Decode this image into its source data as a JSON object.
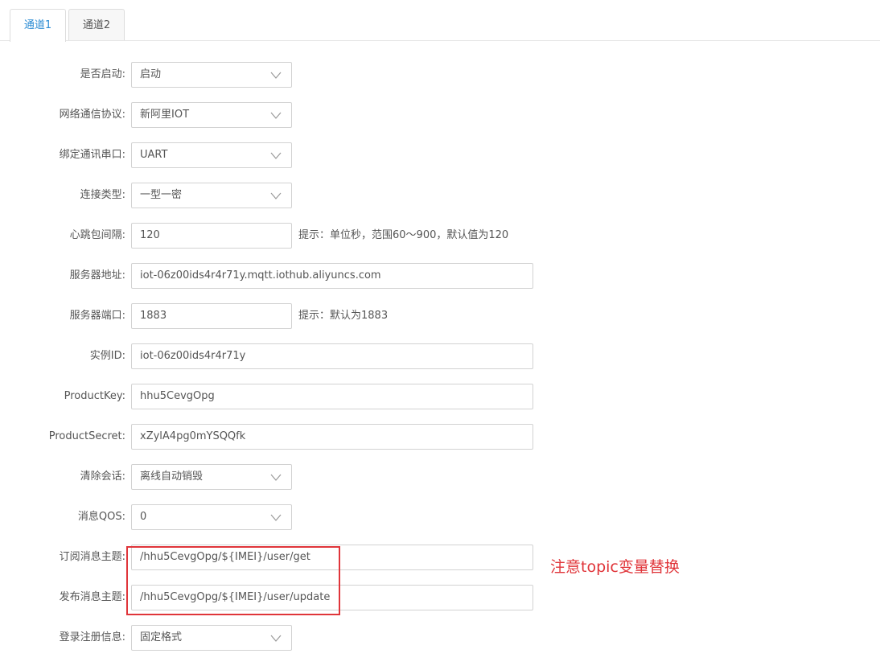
{
  "tabs": [
    {
      "label": "通道1",
      "active": true
    },
    {
      "label": "通道2",
      "active": false
    }
  ],
  "form": {
    "enable": {
      "label": "是否启动:",
      "value": "启动"
    },
    "protocol": {
      "label": "网络通信协议:",
      "value": "新阿里IOT"
    },
    "serial": {
      "label": "绑定通讯串口:",
      "value": "UART"
    },
    "conn_type": {
      "label": "连接类型:",
      "value": "一型一密"
    },
    "heartbeat": {
      "label": "心跳包间隔:",
      "value": "120",
      "hint": "提示：单位秒，范围60～900，默认值为120"
    },
    "server_addr": {
      "label": "服务器地址:",
      "value": "iot-06z00ids4r4r71y.mqtt.iothub.aliyuncs.com"
    },
    "server_port": {
      "label": "服务器端口:",
      "value": "1883",
      "hint": "提示：默认为1883"
    },
    "instance_id": {
      "label": "实例ID:",
      "value": "iot-06z00ids4r4r71y"
    },
    "product_key": {
      "label": "ProductKey:",
      "value": "hhu5CevgOpg"
    },
    "product_secret": {
      "label": "ProductSecret:",
      "value": "xZylA4pg0mYSQQfk"
    },
    "clean_session": {
      "label": "清除会话:",
      "value": "离线自动销毁"
    },
    "qos": {
      "label": "消息QOS:",
      "value": "0"
    },
    "sub_topic": {
      "label": "订阅消息主题:",
      "value": "/hhu5CevgOpg/${IMEI}/user/get"
    },
    "pub_topic": {
      "label": "发布消息主题:",
      "value": "/hhu5CevgOpg/${IMEI}/user/update"
    },
    "login_info": {
      "label": "登录注册信息:",
      "value": "固定格式"
    }
  },
  "annotation": {
    "text": "注意topic变量替换",
    "color": "#e0353a"
  },
  "colors": {
    "accent": "#2a8bd3",
    "border": "#d2d2d2",
    "highlight": "#e0353a"
  },
  "icons": {
    "select_arrow": "chevron-down-icon"
  }
}
